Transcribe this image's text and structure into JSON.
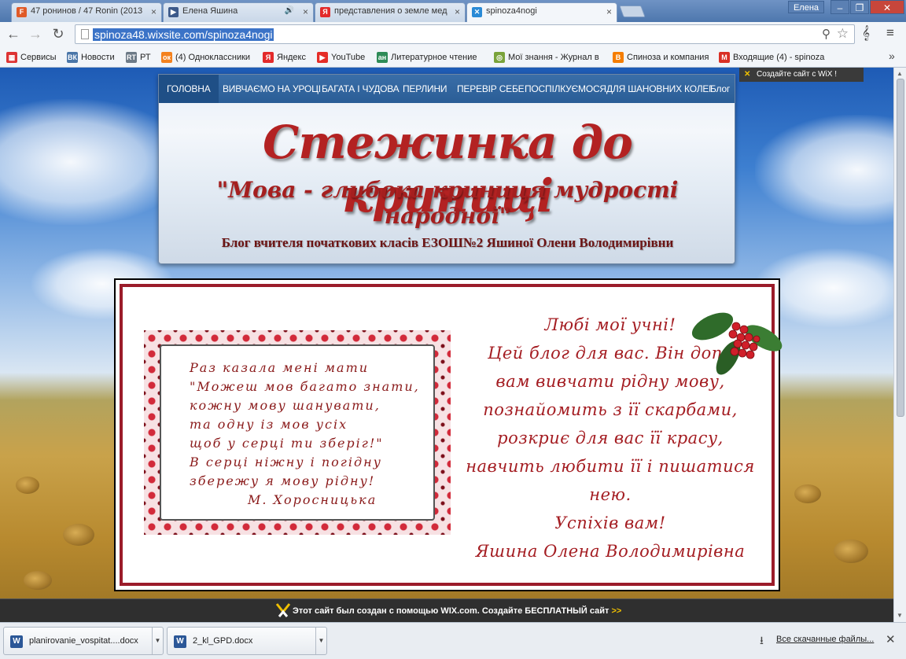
{
  "browser": {
    "tabs": [
      {
        "title": "47 ронинов / 47 Ronin (2013",
        "icon": "F",
        "icon_color": "#e05a28"
      },
      {
        "title": "Елена Яшина",
        "icon": "▶",
        "icon_color": "#3d5a8a"
      },
      {
        "title": "представления о земле мед",
        "icon": "Я",
        "icon_color": "#e32a2a"
      },
      {
        "title": "spinoza4nogi",
        "icon": "✕",
        "icon_color": "#2a8ad6"
      }
    ],
    "tab_close": "×",
    "audio_icon": "🔊",
    "user_name": "Елена",
    "url": "spinoza48.wixsite.com/spinoza4nogi",
    "bookmarks": [
      {
        "label": "Сервисы",
        "icon": "▦",
        "icon_color": "#d33"
      },
      {
        "label": "Новости",
        "icon": "ВК",
        "icon_color": "#4a76a8"
      },
      {
        "label": "РТ",
        "icon": "RT",
        "icon_color": "#6d7a87"
      },
      {
        "label": "(4) Одноклассники",
        "icon": "ок",
        "icon_color": "#f4821f"
      },
      {
        "label": "Яндекс",
        "icon": "Я",
        "icon_color": "#e32a2a"
      },
      {
        "label": "YouTube",
        "icon": "▶",
        "icon_color": "#e52d27"
      },
      {
        "label": "Литературное чтение",
        "icon": "ан",
        "icon_color": "#2e8b57"
      },
      {
        "label": "Мої знання - Журнал в",
        "icon": "◎",
        "icon_color": "#7aa33b"
      },
      {
        "label": "Спиноза и компания",
        "icon": "B",
        "icon_color": "#f57d00"
      },
      {
        "label": "Входящие (4) - spinoza",
        "icon": "M",
        "icon_color": "#d93025"
      }
    ],
    "bookmarks_more": "»"
  },
  "site": {
    "wix_create_label": "Создайте сайт с WiX !",
    "nav": [
      "ГОЛОВНА",
      "ВИВЧАЄМО НА УРОЦІ",
      "БАГАТА І ЧУДОВА",
      "ПЕРЛИНИ",
      "ПЕРЕВІР СЕБЕ",
      "ПОСПІЛКУЄМОСЯ",
      "ДЛЯ ШАНОВНИХ КОЛЕГ",
      "Блог"
    ],
    "title": "Стежинка до криниці",
    "subtitle": "\"Мова - глибока криниця мудрості народної\"",
    "blog_line": "Блог вчителя початкових класів ЕЗОШ№2 Яшиної Олени Володимирівни",
    "poem": [
      "Раз казала мені мати",
      "\"Можеш мов багато знати,",
      "кожну мову шанувати,",
      "та одну із мов усіх",
      "щоб у серці ти зберіг!\"",
      "В серці ніжну і погідну",
      "збережу я мову рідну!",
      "М. Хоросницька"
    ],
    "greeting": [
      "Любі мої учні!",
      "Цей блог для вас. Він допо",
      "вам вивчати рідну мову,",
      "познайомить з її скарбами,",
      "розкриє для вас її красу,",
      "навчить любити її і пишатися",
      "нею.",
      "Успіхів вам!",
      "Яшина Олена Володимирівна"
    ],
    "wix_bar_text": "Этот сайт был создан с помощью WIX.com. Создайте БЕСПЛАТНЫЙ сайт",
    "wix_bar_arrows": ">>"
  },
  "downloads": {
    "items": [
      "planirovanie_vospitat....docx",
      "2_kl_GPD.docx"
    ],
    "all_label": "Все скачанные файлы..."
  },
  "colors": {
    "accent_red": "#a41d22",
    "nav_blue": "#2a5d96"
  }
}
